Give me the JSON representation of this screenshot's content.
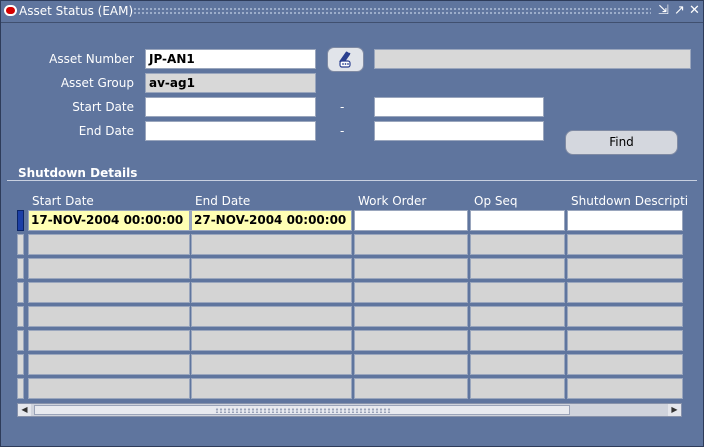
{
  "window": {
    "title": "Asset Status (EAM)",
    "controls": {
      "minimize": "⇲",
      "maximize": "↗",
      "close": "✕"
    }
  },
  "header": {
    "asset_number_label": "Asset Number",
    "asset_number_value": "JP-AN1",
    "asset_description_value": "",
    "asset_group_label": "Asset Group",
    "asset_group_value": "av-ag1",
    "start_date_label": "Start Date",
    "end_date_label": "End Date",
    "range_separator": "-",
    "start_date_from": "",
    "start_date_to": "",
    "end_date_from": "",
    "end_date_to": "",
    "find_label": "Find"
  },
  "shutdown": {
    "title": "Shutdown Details",
    "columns": [
      "Start Date",
      "End Date",
      "Work Order",
      "Op Seq",
      "Shutdown Descripti"
    ],
    "rows": [
      [
        "17-NOV-2004 00:00:00",
        "27-NOV-2004 00:00:00",
        "",
        "",
        ""
      ],
      [
        "",
        "",
        "",
        "",
        ""
      ],
      [
        "",
        "",
        "",
        "",
        ""
      ],
      [
        "",
        "",
        "",
        "",
        ""
      ],
      [
        "",
        "",
        "",
        "",
        ""
      ],
      [
        "",
        "",
        "",
        "",
        ""
      ],
      [
        "",
        "",
        "",
        "",
        ""
      ],
      [
        "",
        "",
        "",
        "",
        ""
      ]
    ]
  },
  "icons": {
    "title": "oracle-logo-icon",
    "flashlight": "flashlight-icon",
    "ellipsis": "ellipsis-icon",
    "scroll_left": "scroll-left-icon",
    "scroll_right": "scroll-right-icon"
  },
  "colors": {
    "window_bg": "#5f759e",
    "current_row_fill": "#ffffb4",
    "current_row_indicator": "#1c3fa6"
  }
}
